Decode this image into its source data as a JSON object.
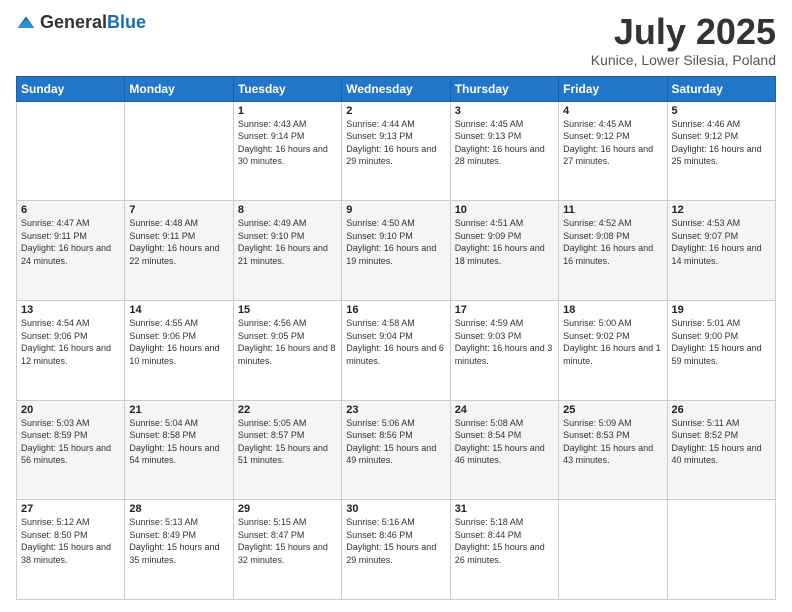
{
  "header": {
    "logo_general": "General",
    "logo_blue": "Blue",
    "month_title": "July 2025",
    "location": "Kunice, Lower Silesia, Poland"
  },
  "days_of_week": [
    "Sunday",
    "Monday",
    "Tuesday",
    "Wednesday",
    "Thursday",
    "Friday",
    "Saturday"
  ],
  "weeks": [
    [
      {
        "day": "",
        "info": ""
      },
      {
        "day": "",
        "info": ""
      },
      {
        "day": "1",
        "info": "Sunrise: 4:43 AM\nSunset: 9:14 PM\nDaylight: 16 hours and 30 minutes."
      },
      {
        "day": "2",
        "info": "Sunrise: 4:44 AM\nSunset: 9:13 PM\nDaylight: 16 hours and 29 minutes."
      },
      {
        "day": "3",
        "info": "Sunrise: 4:45 AM\nSunset: 9:13 PM\nDaylight: 16 hours and 28 minutes."
      },
      {
        "day": "4",
        "info": "Sunrise: 4:45 AM\nSunset: 9:12 PM\nDaylight: 16 hours and 27 minutes."
      },
      {
        "day": "5",
        "info": "Sunrise: 4:46 AM\nSunset: 9:12 PM\nDaylight: 16 hours and 25 minutes."
      }
    ],
    [
      {
        "day": "6",
        "info": "Sunrise: 4:47 AM\nSunset: 9:11 PM\nDaylight: 16 hours and 24 minutes."
      },
      {
        "day": "7",
        "info": "Sunrise: 4:48 AM\nSunset: 9:11 PM\nDaylight: 16 hours and 22 minutes."
      },
      {
        "day": "8",
        "info": "Sunrise: 4:49 AM\nSunset: 9:10 PM\nDaylight: 16 hours and 21 minutes."
      },
      {
        "day": "9",
        "info": "Sunrise: 4:50 AM\nSunset: 9:10 PM\nDaylight: 16 hours and 19 minutes."
      },
      {
        "day": "10",
        "info": "Sunrise: 4:51 AM\nSunset: 9:09 PM\nDaylight: 16 hours and 18 minutes."
      },
      {
        "day": "11",
        "info": "Sunrise: 4:52 AM\nSunset: 9:08 PM\nDaylight: 16 hours and 16 minutes."
      },
      {
        "day": "12",
        "info": "Sunrise: 4:53 AM\nSunset: 9:07 PM\nDaylight: 16 hours and 14 minutes."
      }
    ],
    [
      {
        "day": "13",
        "info": "Sunrise: 4:54 AM\nSunset: 9:06 PM\nDaylight: 16 hours and 12 minutes."
      },
      {
        "day": "14",
        "info": "Sunrise: 4:55 AM\nSunset: 9:06 PM\nDaylight: 16 hours and 10 minutes."
      },
      {
        "day": "15",
        "info": "Sunrise: 4:56 AM\nSunset: 9:05 PM\nDaylight: 16 hours and 8 minutes."
      },
      {
        "day": "16",
        "info": "Sunrise: 4:58 AM\nSunset: 9:04 PM\nDaylight: 16 hours and 6 minutes."
      },
      {
        "day": "17",
        "info": "Sunrise: 4:59 AM\nSunset: 9:03 PM\nDaylight: 16 hours and 3 minutes."
      },
      {
        "day": "18",
        "info": "Sunrise: 5:00 AM\nSunset: 9:02 PM\nDaylight: 16 hours and 1 minute."
      },
      {
        "day": "19",
        "info": "Sunrise: 5:01 AM\nSunset: 9:00 PM\nDaylight: 15 hours and 59 minutes."
      }
    ],
    [
      {
        "day": "20",
        "info": "Sunrise: 5:03 AM\nSunset: 8:59 PM\nDaylight: 15 hours and 56 minutes."
      },
      {
        "day": "21",
        "info": "Sunrise: 5:04 AM\nSunset: 8:58 PM\nDaylight: 15 hours and 54 minutes."
      },
      {
        "day": "22",
        "info": "Sunrise: 5:05 AM\nSunset: 8:57 PM\nDaylight: 15 hours and 51 minutes."
      },
      {
        "day": "23",
        "info": "Sunrise: 5:06 AM\nSunset: 8:56 PM\nDaylight: 15 hours and 49 minutes."
      },
      {
        "day": "24",
        "info": "Sunrise: 5:08 AM\nSunset: 8:54 PM\nDaylight: 15 hours and 46 minutes."
      },
      {
        "day": "25",
        "info": "Sunrise: 5:09 AM\nSunset: 8:53 PM\nDaylight: 15 hours and 43 minutes."
      },
      {
        "day": "26",
        "info": "Sunrise: 5:11 AM\nSunset: 8:52 PM\nDaylight: 15 hours and 40 minutes."
      }
    ],
    [
      {
        "day": "27",
        "info": "Sunrise: 5:12 AM\nSunset: 8:50 PM\nDaylight: 15 hours and 38 minutes."
      },
      {
        "day": "28",
        "info": "Sunrise: 5:13 AM\nSunset: 8:49 PM\nDaylight: 15 hours and 35 minutes."
      },
      {
        "day": "29",
        "info": "Sunrise: 5:15 AM\nSunset: 8:47 PM\nDaylight: 15 hours and 32 minutes."
      },
      {
        "day": "30",
        "info": "Sunrise: 5:16 AM\nSunset: 8:46 PM\nDaylight: 15 hours and 29 minutes."
      },
      {
        "day": "31",
        "info": "Sunrise: 5:18 AM\nSunset: 8:44 PM\nDaylight: 15 hours and 26 minutes."
      },
      {
        "day": "",
        "info": ""
      },
      {
        "day": "",
        "info": ""
      }
    ]
  ]
}
